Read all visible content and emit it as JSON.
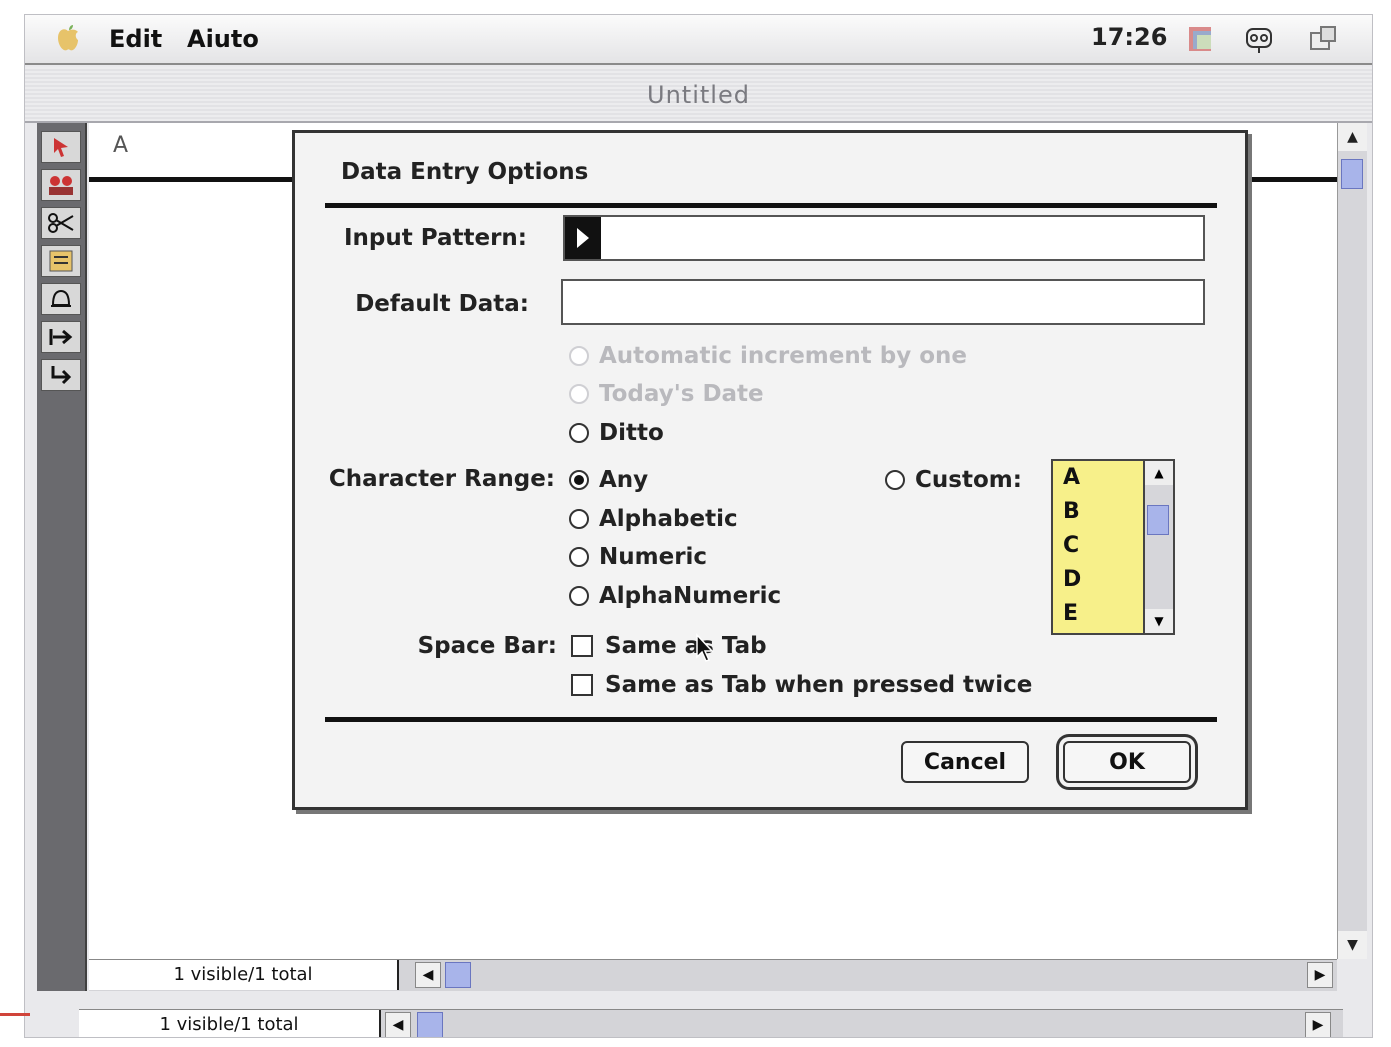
{
  "menubar": {
    "items": [
      "Edit",
      "Aiuto"
    ],
    "clock": "17:26",
    "icons": [
      "apple-icon",
      "app-switcher-icon",
      "network-icon",
      "desktop-icon"
    ]
  },
  "window": {
    "title": "Untitled",
    "column_header": "A",
    "status": {
      "inner_count": "1 visible/1 total",
      "outer_count": "1 visible/1 total"
    },
    "tool_icons": [
      "pointer-tool-icon",
      "people-tool-icon",
      "scissors-tool-icon",
      "notes-tool-icon",
      "bell-tool-icon",
      "tab-right-tool-icon",
      "return-tool-icon"
    ]
  },
  "dialog": {
    "title": "Data Entry Options",
    "input_pattern_label": "Input Pattern:",
    "input_pattern_value": "",
    "default_data_label": "Default Data:",
    "default_data_value": "",
    "default_options": [
      {
        "label": "Automatic increment by one",
        "enabled": false,
        "selected": false
      },
      {
        "label": "Today's Date",
        "enabled": false,
        "selected": false
      },
      {
        "label": "Ditto",
        "enabled": true,
        "selected": false
      }
    ],
    "character_range_label": "Character Range:",
    "character_range_options": [
      {
        "label": "Any",
        "selected": true
      },
      {
        "label": "Alphabetic",
        "selected": false
      },
      {
        "label": "Numeric",
        "selected": false
      },
      {
        "label": "AlphaNumeric",
        "selected": false
      }
    ],
    "custom_label": "Custom:",
    "custom_list": [
      "A",
      "B",
      "C",
      "D",
      "E"
    ],
    "space_bar_label": "Space Bar:",
    "space_bar_options": [
      {
        "label": "Same as Tab",
        "checked": false
      },
      {
        "label": "Same as Tab when pressed twice",
        "checked": false
      }
    ],
    "cancel_label": "Cancel",
    "ok_label": "OK"
  },
  "colors": {
    "custom_list_bg": "#f7f08a",
    "scroll_thumb": "#a8b4ea"
  }
}
